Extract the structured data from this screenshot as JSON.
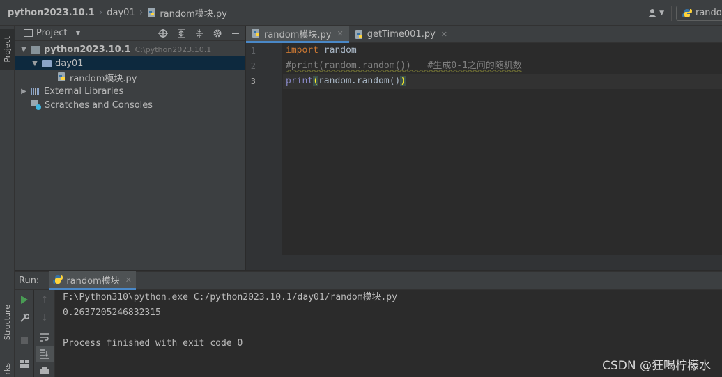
{
  "navbar": {
    "breadcrumbs": [
      "python2023.10.1",
      "day01",
      "random模块.py"
    ],
    "run_config_label": "rando"
  },
  "left_strip": {
    "project_label": "Project",
    "structure_label": "Structure",
    "bookmarks_label": "rks"
  },
  "project_panel": {
    "title": "Project",
    "tree": {
      "root_name": "python2023.10.1",
      "root_path": "C:\\python2023.10.1",
      "folder": "day01",
      "file": "random模块.py",
      "external_libraries": "External Libraries",
      "scratches": "Scratches and Consoles"
    }
  },
  "editor": {
    "tabs": [
      {
        "label": "random模块.py",
        "active": true
      },
      {
        "label": "getTime001.py",
        "active": false
      }
    ],
    "line_numbers": [
      "1",
      "2",
      "3"
    ],
    "code": {
      "line1_kw": "import",
      "line1_rest": " random",
      "line2": "#print(random.random())   #生成0-1之间的随机数",
      "line3_fn": "print",
      "line3_open": "(",
      "line3_mid": "random.random()",
      "line3_close": ")"
    }
  },
  "run_panel": {
    "label": "Run:",
    "tab_label": "random模块",
    "output": [
      "F:\\Python310\\python.exe C:/python2023.10.1/day01/random模块.py",
      "0.2637205246832315",
      "",
      "Process finished with exit code 0"
    ]
  },
  "watermark": "CSDN @狂喝柠檬水",
  "colors": {
    "accent": "#4a88c7",
    "keyword": "#cc7832",
    "builtin": "#8888c6",
    "comment": "#808080"
  }
}
